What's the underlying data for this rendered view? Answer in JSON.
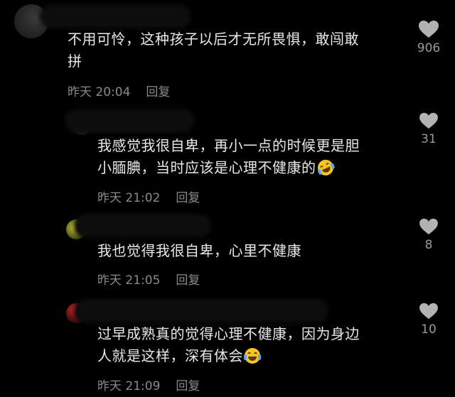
{
  "comments": [
    {
      "text_line1": "不用可怜，这种孩子以后才无所畏惧，敢闯敢",
      "text_line2": "拼",
      "time": "昨天 20:04",
      "reply": "回复",
      "likes": "906"
    },
    {
      "text_line1": "我感觉我很自卑，再小一点的时候更是胆",
      "text_line2": "小腼腆，当时应该是心理不健康的",
      "emoji": "rolling-laughing-emoji",
      "time": "昨天 21:02",
      "reply": "回复",
      "likes": "31"
    },
    {
      "text_line1": "我也觉得我很自卑，心里不健康",
      "time": "昨天 21:05",
      "reply": "回复",
      "likes": "8"
    },
    {
      "text_line1": "过早成熟真的觉得心理不健康，因为身边",
      "text_line2": "人就是这样，深有体会",
      "emoji": "crying-laughing-emoji",
      "time": "昨天 21:09",
      "reply": "回复",
      "likes": "10"
    }
  ],
  "colors": {
    "background": "#000000",
    "text": "#e8e8e8",
    "meta": "#8a8a8a",
    "heart": "#b3b3b3"
  }
}
